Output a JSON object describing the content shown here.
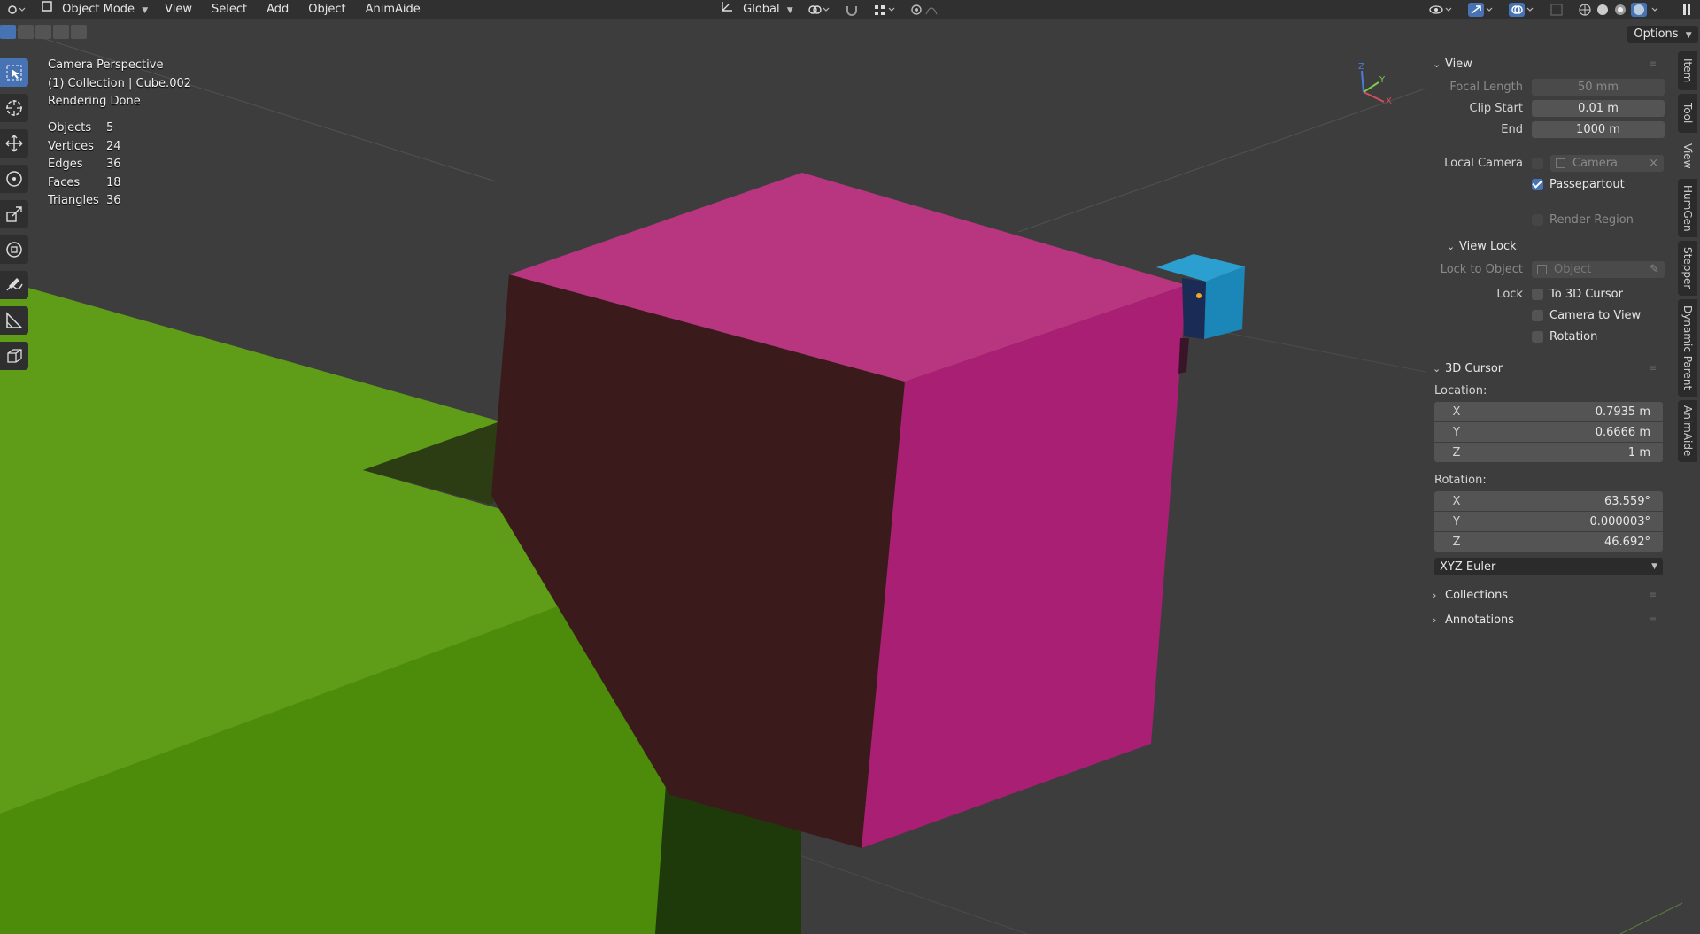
{
  "header": {
    "mode_label": "Object Mode",
    "menus": [
      "View",
      "Select",
      "Add",
      "Object",
      "AnimAide"
    ],
    "orientation_label": "Global"
  },
  "options_label": "Options",
  "overlay": {
    "line1": "Camera Perspective",
    "line2": "(1) Collection | Cube.002",
    "line3": "Rendering Done"
  },
  "stats": [
    {
      "label": "Objects",
      "value": "5"
    },
    {
      "label": "Vertices",
      "value": "24"
    },
    {
      "label": "Edges",
      "value": "36"
    },
    {
      "label": "Faces",
      "value": "18"
    },
    {
      "label": "Triangles",
      "value": "36"
    }
  ],
  "panel": {
    "view_title": "View",
    "focal_length_label": "Focal Length",
    "focal_length_value": "50 mm",
    "clip_start_label": "Clip Start",
    "clip_start_value": "0.01 m",
    "clip_end_label": "End",
    "clip_end_value": "1000 m",
    "local_camera_label": "Local Camera",
    "local_camera_value": "Camera",
    "passepartout_label": "Passepartout",
    "render_region_label": "Render Region",
    "view_lock_title": "View Lock",
    "lock_to_object_label": "Lock to Object",
    "lock_to_object_placeholder": "Object",
    "lock_label": "Lock",
    "to_3d_cursor_label": "To 3D Cursor",
    "camera_to_view_label": "Camera to View",
    "rotation_lock_label": "Rotation",
    "cursor_title": "3D Cursor",
    "location_label": "Location:",
    "location": [
      {
        "axis": "X",
        "value": "0.7935 m"
      },
      {
        "axis": "Y",
        "value": "0.6666 m"
      },
      {
        "axis": "Z",
        "value": "1 m"
      }
    ],
    "rotation_label": "Rotation:",
    "rotation": [
      {
        "axis": "X",
        "value": "63.559°"
      },
      {
        "axis": "Y",
        "value": "0.000003°"
      },
      {
        "axis": "Z",
        "value": "46.692°"
      }
    ],
    "rotation_mode": "XYZ Euler",
    "collections_title": "Collections",
    "annotations_title": "Annotations"
  },
  "side_tabs": [
    "Item",
    "Tool",
    "View",
    "HumGen",
    "Stepper",
    "Dynamic Parent",
    "AnimAide"
  ],
  "gizmo": {
    "x": "X",
    "y": "Y",
    "z": "Z"
  },
  "colors": {
    "magenta_top": "#b8367f",
    "magenta_front": "#a81f73",
    "magenta_shadow": "#3b1a1c",
    "green_top": "#5f9c18",
    "green_front": "#4c8c0a",
    "cyan_cube": "#1b87b8",
    "accent": "#4772b3"
  }
}
